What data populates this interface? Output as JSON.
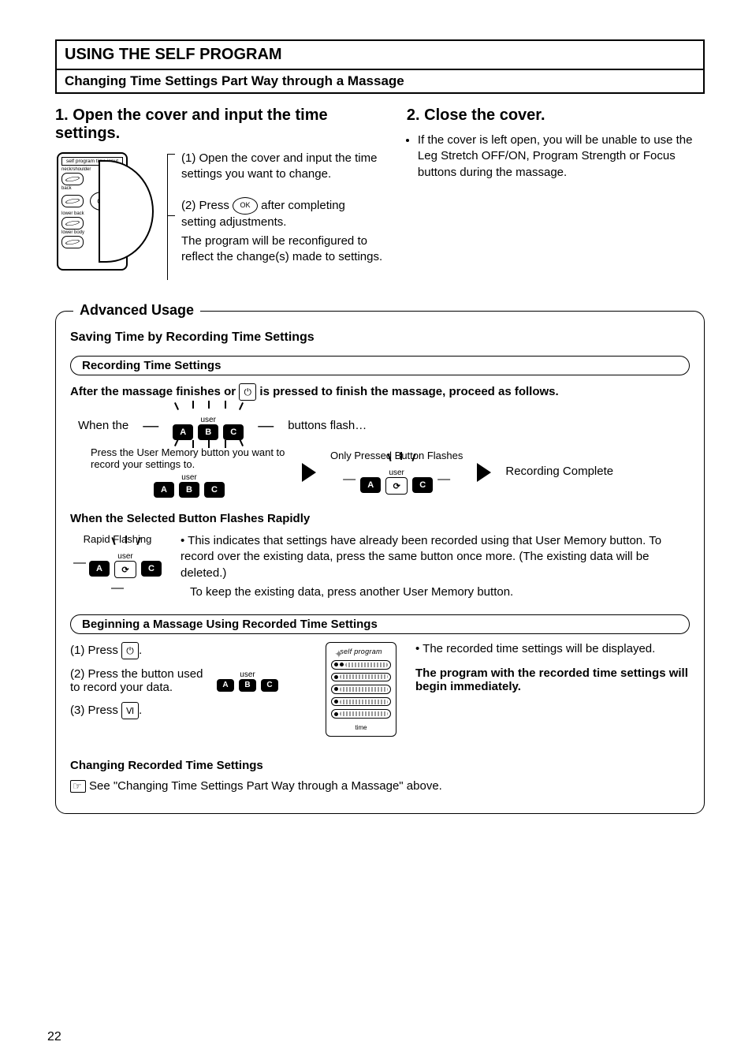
{
  "page_number": "22",
  "title": "USING THE SELF PROGRAM",
  "subhead": "Changing Time Settings Part Way through a Massage",
  "step1": {
    "heading": "1. Open the cover and input the time settings.",
    "panel_top_label": "self program time input",
    "panel_rows": [
      "neck/shoulder",
      "back",
      "lower back",
      "lower body"
    ],
    "ok": "OK",
    "sub1_prefix": "(1) ",
    "sub1": "Open the cover and input the time settings you want to change.",
    "sub2_prefix": "(2) ",
    "sub2a": "Press ",
    "sub2_btn": "OK",
    "sub2b": " after completing setting adjustments.",
    "sub2c": "The program will be reconfigured to reflect the change(s) made to settings."
  },
  "step2": {
    "heading": "2. Close the cover.",
    "bullet": "If the cover is left open, you will be unable to use the Leg Stretch OFF/ON, Program Strength or Focus buttons during the massage."
  },
  "advanced": {
    "title": "Advanced Usage",
    "subhead": "Saving Time by Recording Time Settings",
    "pill_recording": "Recording Time Settings",
    "after_a": "After the massage finishes or ",
    "after_b": " is pressed to finish the massage, proceed as follows.",
    "when_the": "When the",
    "buttons_flash": "buttons flash…",
    "user_label": "user",
    "press_memory": "Press the User Memory button you want to record your settings to.",
    "only_pressed": "Only Pressed Button Flashes",
    "recording_complete": "Recording Complete",
    "rapid_heading": "When the Selected Button Flashes Rapidly",
    "rapid_caption": "Rapid Flashing",
    "rapid_bullet_a": "This indicates that settings have already been recorded using that User Memory button. To record over the existing data, press the same button once more. (The existing data will be deleted.)",
    "rapid_bullet_b": "To keep the existing data, press another User Memory button.",
    "pill_begin": "Beginning a Massage Using Recorded Time Settings",
    "begin1_a": "(1) Press ",
    "begin1_b": ".",
    "begin2": "(2) Press the button used to record your data.",
    "begin3_a": "(3) Press ",
    "begin3_b": ".",
    "sp_head": "self program",
    "sp_time": "time",
    "recorded_disp": "The recorded time settings will be displayed.",
    "program_will": "The program with the recorded time settings will begin immediately.",
    "changing_head": "Changing Recorded Time Settings",
    "changing_ref": "See \"Changing Time Settings Part Way through a Massage\" above."
  },
  "icons": {
    "power": "⏻",
    "roman_six": "Ⅵ",
    "loop": "⟳"
  },
  "abc": {
    "a": "A",
    "b": "B",
    "c": "C"
  }
}
